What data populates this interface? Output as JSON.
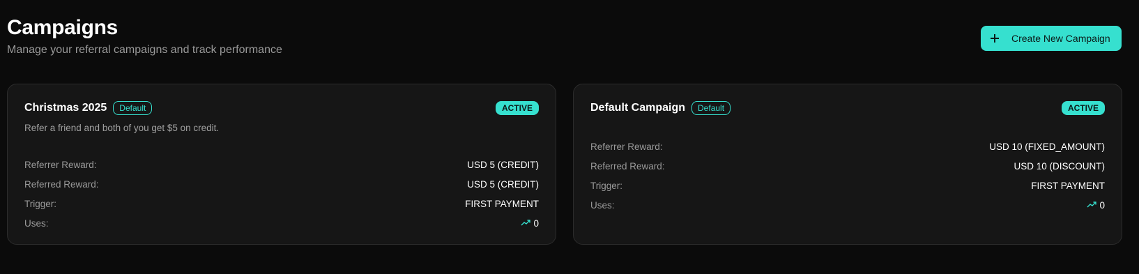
{
  "header": {
    "title": "Campaigns",
    "subtitle": "Manage your referral campaigns and track performance"
  },
  "actions": {
    "create_label": "Create New Campaign"
  },
  "campaigns": [
    {
      "name": "Christmas 2025",
      "default_label": "Default",
      "status": "ACTIVE",
      "description": "Refer a friend and both of you get $5 on credit.",
      "referrer_label": "Referrer Reward:",
      "referrer_value": "USD 5 (CREDIT)",
      "referred_label": "Referred Reward:",
      "referred_value": "USD 5 (CREDIT)",
      "trigger_label": "Trigger:",
      "trigger_value": "FIRST PAYMENT",
      "uses_label": "Uses:",
      "uses_value": "0"
    },
    {
      "name": "Default Campaign",
      "default_label": "Default",
      "status": "ACTIVE",
      "referrer_label": "Referrer Reward:",
      "referrer_value": "USD 10 (FIXED_AMOUNT)",
      "referred_label": "Referred Reward:",
      "referred_value": "USD 10 (DISCOUNT)",
      "trigger_label": "Trigger:",
      "trigger_value": "FIRST PAYMENT",
      "uses_label": "Uses:",
      "uses_value": "0"
    }
  ],
  "colors": {
    "accent": "#36e0cf",
    "background": "#0b0b0b",
    "card": "#161616"
  },
  "icons": {
    "create": "plus-icon",
    "uses": "trending-up-icon"
  }
}
